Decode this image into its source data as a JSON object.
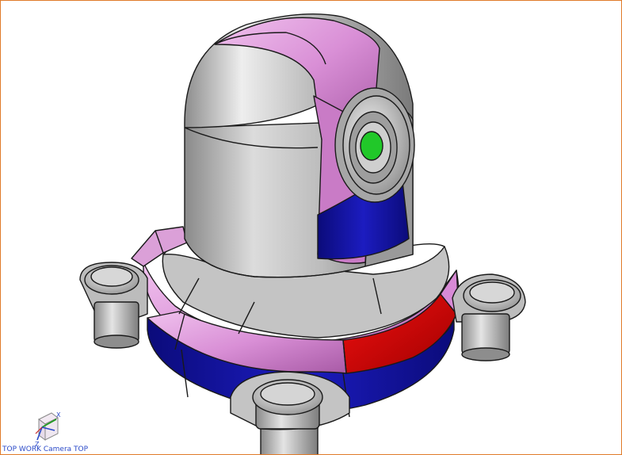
{
  "viewport": {
    "border_color": "#e07b2a",
    "background": "#ffffff"
  },
  "model": {
    "colors": {
      "housing": "#b8b8b8",
      "highlight_pink": "#e6a1e3",
      "face_blue": "#1a1aa8",
      "face_red": "#d60a0a",
      "lens_green": "#21c829",
      "edge": "#1a1a1a"
    }
  },
  "triad": {
    "x_label": "X",
    "z_label": "Z"
  },
  "view_label": "TOP WORK Camera TOP"
}
